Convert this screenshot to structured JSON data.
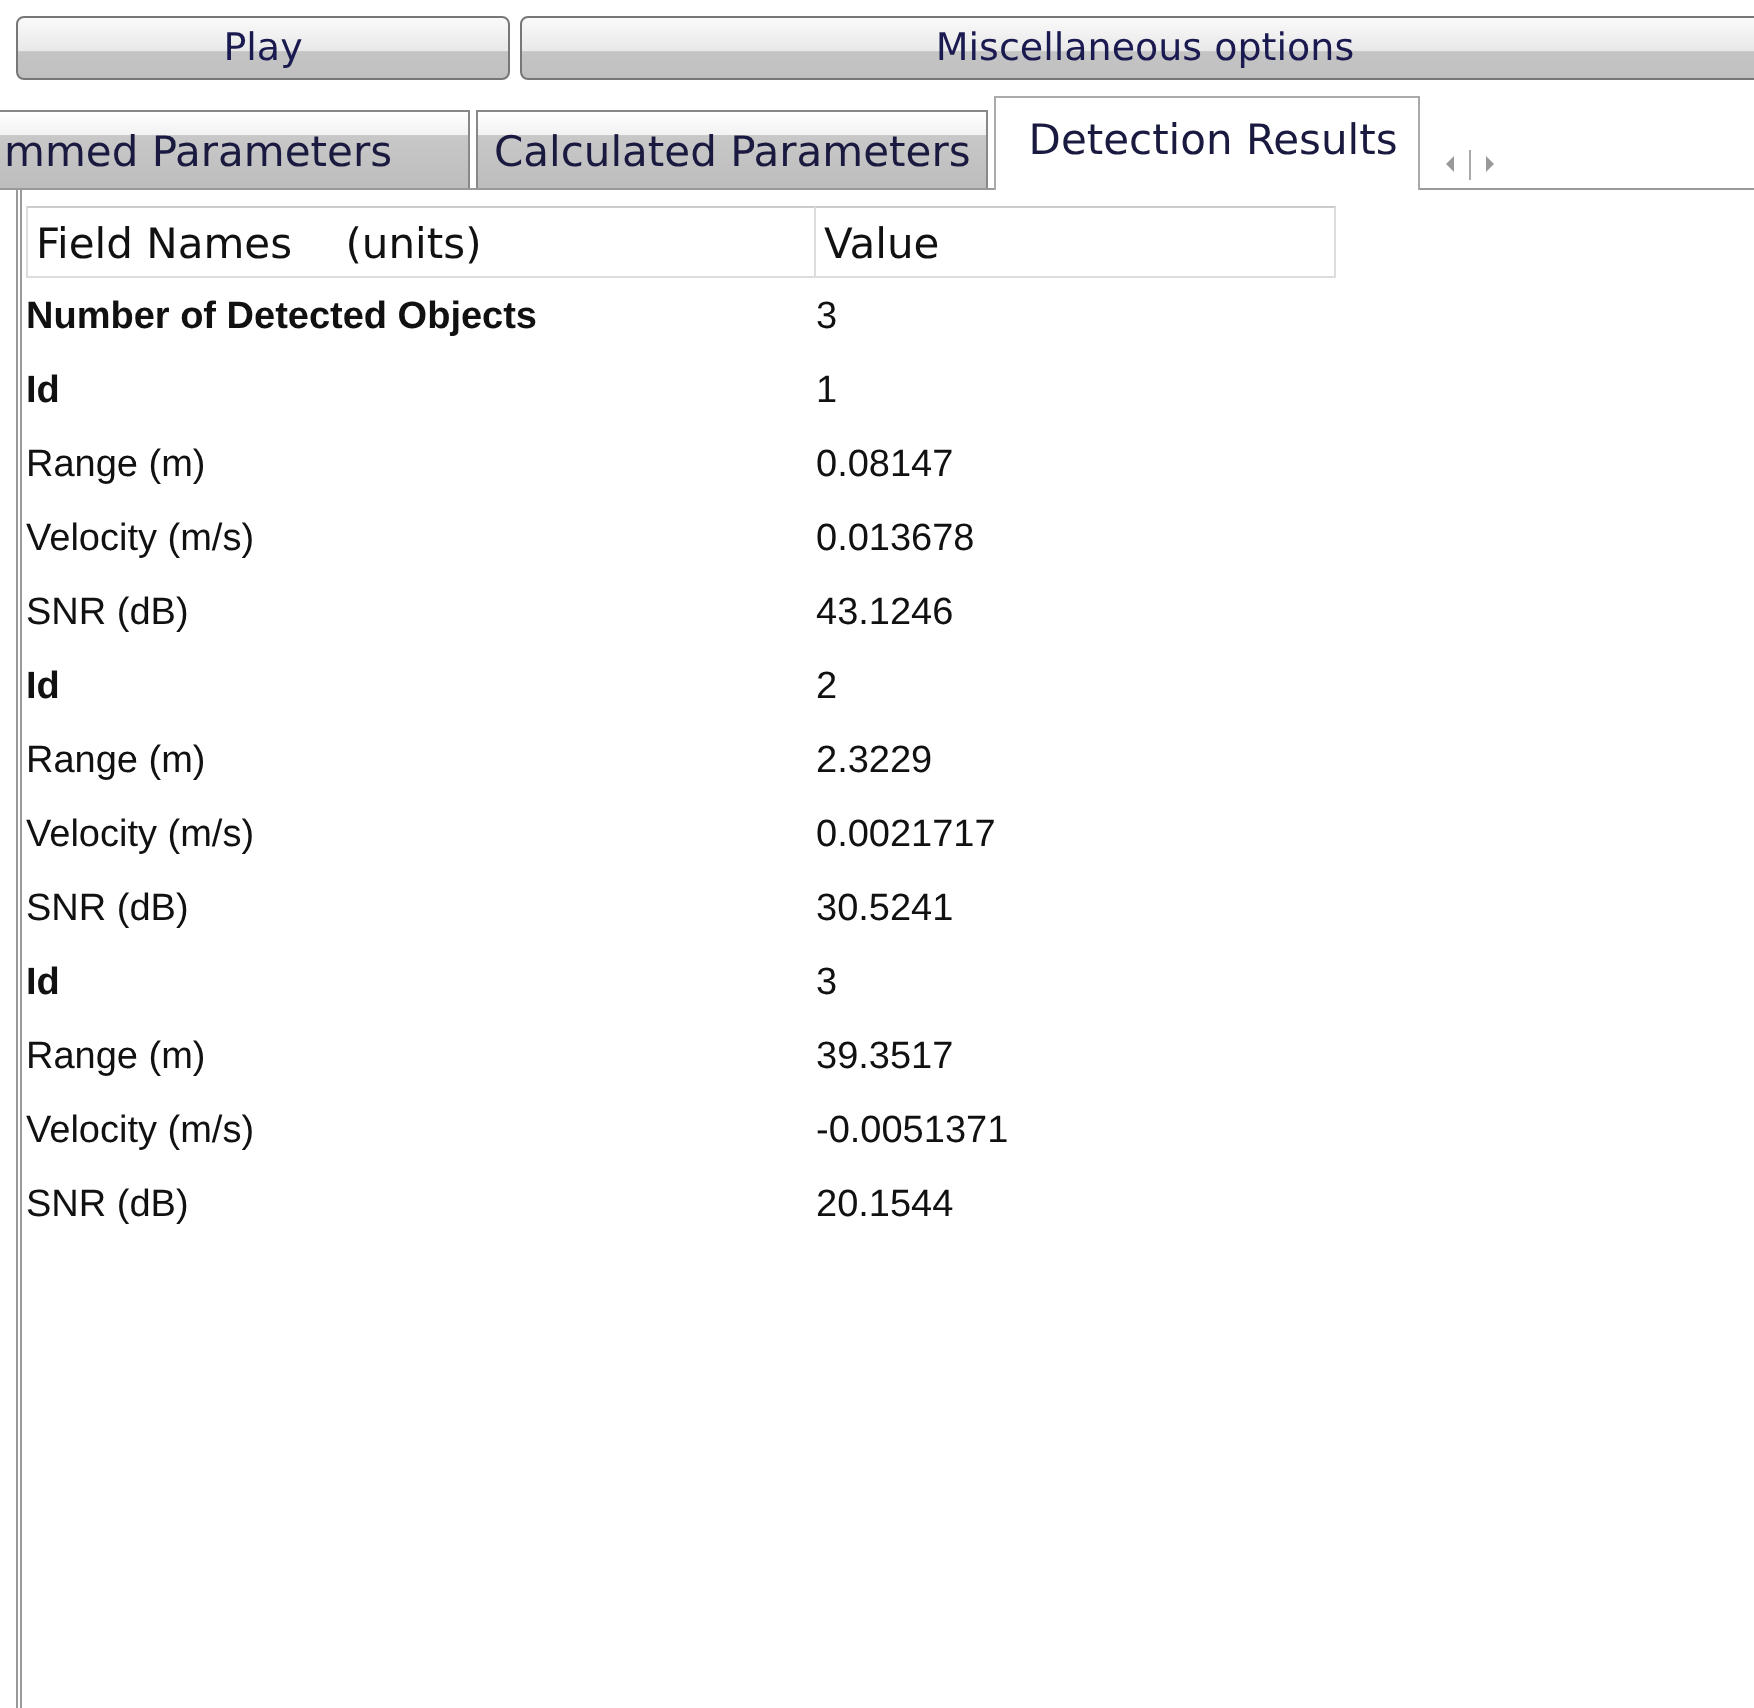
{
  "buttons": [
    {
      "label": "Play"
    },
    {
      "label": "Miscellaneous options"
    }
  ],
  "tabs": [
    {
      "label": "mmed Parameters",
      "selected": false
    },
    {
      "label": "Calculated Parameters",
      "selected": false
    },
    {
      "label": "Detection Results",
      "selected": true
    }
  ],
  "table": {
    "columns": [
      "Field Names    (units)",
      "Value"
    ],
    "rows": [
      {
        "kind": "heading",
        "field": "Number of Detected Objects",
        "value": "3"
      },
      {
        "kind": "heading",
        "field": "Id",
        "value": "1"
      },
      {
        "kind": "field",
        "field": "Range (m)",
        "value": "0.08147"
      },
      {
        "kind": "field",
        "field": "Velocity (m/s)",
        "value": "0.013678"
      },
      {
        "kind": "field",
        "field": "SNR (dB)",
        "value": "43.1246"
      },
      {
        "kind": "heading",
        "field": "Id",
        "value": "2"
      },
      {
        "kind": "field",
        "field": "Range (m)",
        "value": "2.3229"
      },
      {
        "kind": "field",
        "field": "Velocity (m/s)",
        "value": "0.0021717"
      },
      {
        "kind": "field",
        "field": "SNR (dB)",
        "value": "30.5241"
      },
      {
        "kind": "heading",
        "field": "Id",
        "value": "3"
      },
      {
        "kind": "field",
        "field": "Range (m)",
        "value": "39.3517"
      },
      {
        "kind": "field",
        "field": "Velocity (m/s)",
        "value": "-0.0051371"
      },
      {
        "kind": "field",
        "field": "SNR (dB)",
        "value": "20.1544"
      }
    ]
  }
}
